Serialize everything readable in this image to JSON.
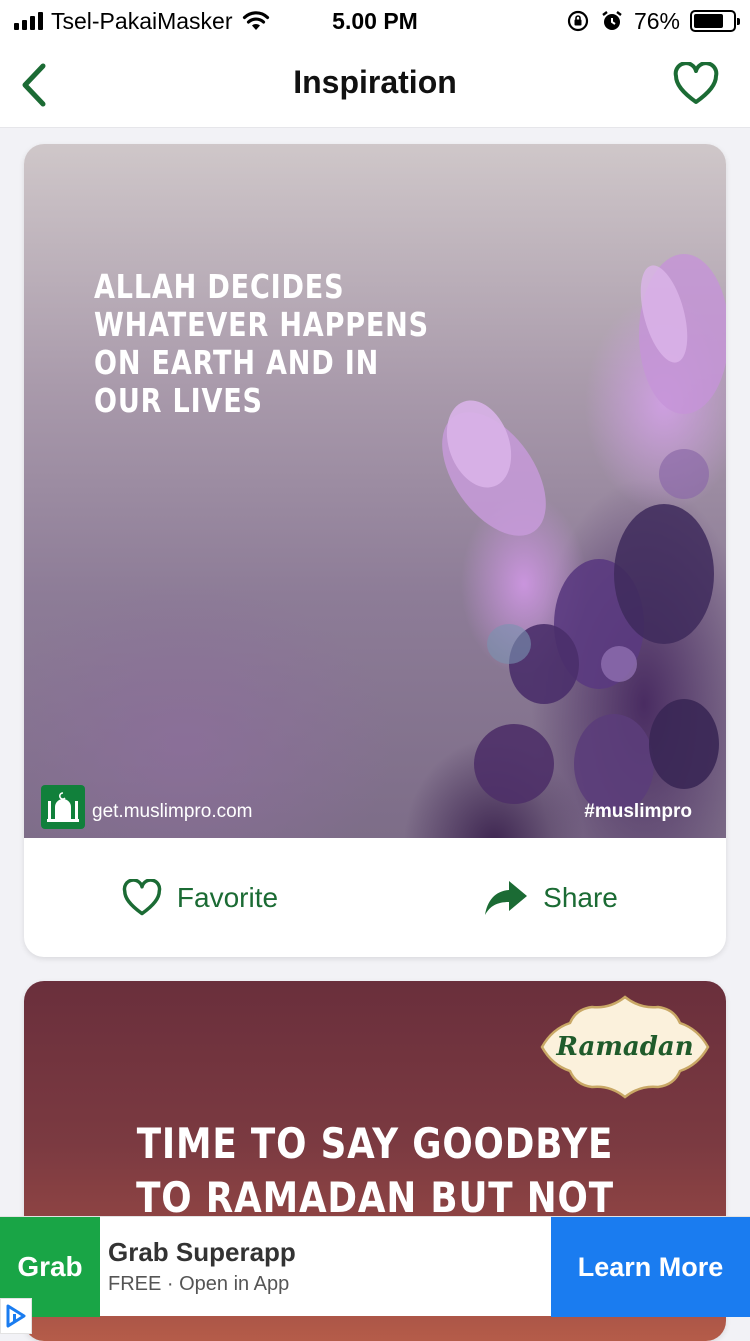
{
  "status_bar": {
    "carrier": "Tsel-PakaiMasker",
    "time": "5.00 PM",
    "battery_percent": "76%",
    "battery_level": 0.76
  },
  "nav": {
    "title": "Inspiration",
    "back_icon": "chevron-left-icon",
    "favorite_icon": "heart-outline-icon",
    "accent_color": "#1b6b34"
  },
  "cards": [
    {
      "quote": "ALLAH DECIDES WHATEVER HAPPENS ON EARTH AND IN OUR LIVES",
      "brand_url": "get.muslimpro.com",
      "hashtag": "#muslimpro",
      "favorite_label": "Favorite",
      "share_label": "Share"
    },
    {
      "badge": "Ramadan",
      "quote_line1": "TIME TO SAY GOODBYE",
      "quote_line2": "TO RAMADAN BUT NOT"
    }
  ],
  "ad": {
    "logo_text": "Grab",
    "title": "Grab Superapp",
    "subtitle": "FREE · Open in App",
    "cta": "Learn More",
    "cta_color": "#1a7cf0",
    "logo_color": "#19a546"
  }
}
